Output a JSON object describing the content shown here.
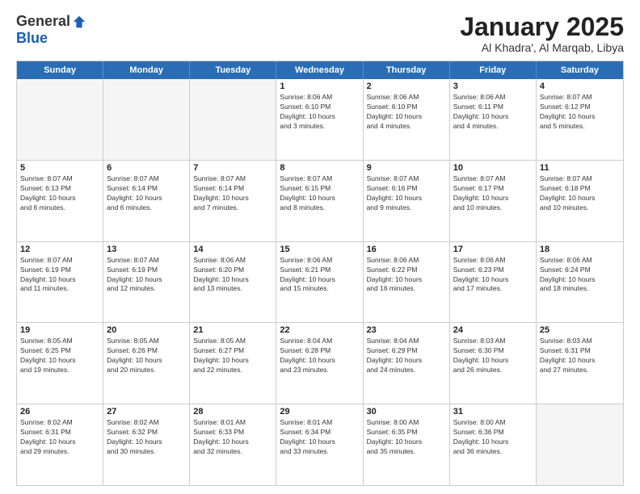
{
  "logo": {
    "general": "General",
    "blue": "Blue"
  },
  "title": "January 2025",
  "subtitle": "Al Khadra', Al Marqab, Libya",
  "days": [
    "Sunday",
    "Monday",
    "Tuesday",
    "Wednesday",
    "Thursday",
    "Friday",
    "Saturday"
  ],
  "rows": [
    [
      {
        "day": "",
        "lines": [],
        "empty": true
      },
      {
        "day": "",
        "lines": [],
        "empty": true
      },
      {
        "day": "",
        "lines": [],
        "empty": true
      },
      {
        "day": "1",
        "lines": [
          "Sunrise: 8:06 AM",
          "Sunset: 6:10 PM",
          "Daylight: 10 hours",
          "and 3 minutes."
        ]
      },
      {
        "day": "2",
        "lines": [
          "Sunrise: 8:06 AM",
          "Sunset: 6:10 PM",
          "Daylight: 10 hours",
          "and 4 minutes."
        ]
      },
      {
        "day": "3",
        "lines": [
          "Sunrise: 8:06 AM",
          "Sunset: 6:11 PM",
          "Daylight: 10 hours",
          "and 4 minutes."
        ]
      },
      {
        "day": "4",
        "lines": [
          "Sunrise: 8:07 AM",
          "Sunset: 6:12 PM",
          "Daylight: 10 hours",
          "and 5 minutes."
        ]
      }
    ],
    [
      {
        "day": "5",
        "lines": [
          "Sunrise: 8:07 AM",
          "Sunset: 6:13 PM",
          "Daylight: 10 hours",
          "and 6 minutes."
        ]
      },
      {
        "day": "6",
        "lines": [
          "Sunrise: 8:07 AM",
          "Sunset: 6:14 PM",
          "Daylight: 10 hours",
          "and 6 minutes."
        ]
      },
      {
        "day": "7",
        "lines": [
          "Sunrise: 8:07 AM",
          "Sunset: 6:14 PM",
          "Daylight: 10 hours",
          "and 7 minutes."
        ]
      },
      {
        "day": "8",
        "lines": [
          "Sunrise: 8:07 AM",
          "Sunset: 6:15 PM",
          "Daylight: 10 hours",
          "and 8 minutes."
        ]
      },
      {
        "day": "9",
        "lines": [
          "Sunrise: 8:07 AM",
          "Sunset: 6:16 PM",
          "Daylight: 10 hours",
          "and 9 minutes."
        ]
      },
      {
        "day": "10",
        "lines": [
          "Sunrise: 8:07 AM",
          "Sunset: 6:17 PM",
          "Daylight: 10 hours",
          "and 10 minutes."
        ]
      },
      {
        "day": "11",
        "lines": [
          "Sunrise: 8:07 AM",
          "Sunset: 6:18 PM",
          "Daylight: 10 hours",
          "and 10 minutes."
        ]
      }
    ],
    [
      {
        "day": "12",
        "lines": [
          "Sunrise: 8:07 AM",
          "Sunset: 6:19 PM",
          "Daylight: 10 hours",
          "and 11 minutes."
        ]
      },
      {
        "day": "13",
        "lines": [
          "Sunrise: 8:07 AM",
          "Sunset: 6:19 PM",
          "Daylight: 10 hours",
          "and 12 minutes."
        ]
      },
      {
        "day": "14",
        "lines": [
          "Sunrise: 8:06 AM",
          "Sunset: 6:20 PM",
          "Daylight: 10 hours",
          "and 13 minutes."
        ]
      },
      {
        "day": "15",
        "lines": [
          "Sunrise: 8:06 AM",
          "Sunset: 6:21 PM",
          "Daylight: 10 hours",
          "and 15 minutes."
        ]
      },
      {
        "day": "16",
        "lines": [
          "Sunrise: 8:06 AM",
          "Sunset: 6:22 PM",
          "Daylight: 10 hours",
          "and 16 minutes."
        ]
      },
      {
        "day": "17",
        "lines": [
          "Sunrise: 8:06 AM",
          "Sunset: 6:23 PM",
          "Daylight: 10 hours",
          "and 17 minutes."
        ]
      },
      {
        "day": "18",
        "lines": [
          "Sunrise: 8:06 AM",
          "Sunset: 6:24 PM",
          "Daylight: 10 hours",
          "and 18 minutes."
        ]
      }
    ],
    [
      {
        "day": "19",
        "lines": [
          "Sunrise: 8:05 AM",
          "Sunset: 6:25 PM",
          "Daylight: 10 hours",
          "and 19 minutes."
        ]
      },
      {
        "day": "20",
        "lines": [
          "Sunrise: 8:05 AM",
          "Sunset: 6:26 PM",
          "Daylight: 10 hours",
          "and 20 minutes."
        ]
      },
      {
        "day": "21",
        "lines": [
          "Sunrise: 8:05 AM",
          "Sunset: 6:27 PM",
          "Daylight: 10 hours",
          "and 22 minutes."
        ]
      },
      {
        "day": "22",
        "lines": [
          "Sunrise: 8:04 AM",
          "Sunset: 6:28 PM",
          "Daylight: 10 hours",
          "and 23 minutes."
        ]
      },
      {
        "day": "23",
        "lines": [
          "Sunrise: 8:04 AM",
          "Sunset: 6:29 PM",
          "Daylight: 10 hours",
          "and 24 minutes."
        ]
      },
      {
        "day": "24",
        "lines": [
          "Sunrise: 8:03 AM",
          "Sunset: 6:30 PM",
          "Daylight: 10 hours",
          "and 26 minutes."
        ]
      },
      {
        "day": "25",
        "lines": [
          "Sunrise: 8:03 AM",
          "Sunset: 6:31 PM",
          "Daylight: 10 hours",
          "and 27 minutes."
        ]
      }
    ],
    [
      {
        "day": "26",
        "lines": [
          "Sunrise: 8:02 AM",
          "Sunset: 6:31 PM",
          "Daylight: 10 hours",
          "and 29 minutes."
        ]
      },
      {
        "day": "27",
        "lines": [
          "Sunrise: 8:02 AM",
          "Sunset: 6:32 PM",
          "Daylight: 10 hours",
          "and 30 minutes."
        ]
      },
      {
        "day": "28",
        "lines": [
          "Sunrise: 8:01 AM",
          "Sunset: 6:33 PM",
          "Daylight: 10 hours",
          "and 32 minutes."
        ]
      },
      {
        "day": "29",
        "lines": [
          "Sunrise: 8:01 AM",
          "Sunset: 6:34 PM",
          "Daylight: 10 hours",
          "and 33 minutes."
        ]
      },
      {
        "day": "30",
        "lines": [
          "Sunrise: 8:00 AM",
          "Sunset: 6:35 PM",
          "Daylight: 10 hours",
          "and 35 minutes."
        ]
      },
      {
        "day": "31",
        "lines": [
          "Sunrise: 8:00 AM",
          "Sunset: 6:36 PM",
          "Daylight: 10 hours",
          "and 36 minutes."
        ]
      },
      {
        "day": "",
        "lines": [],
        "empty": true
      }
    ]
  ]
}
